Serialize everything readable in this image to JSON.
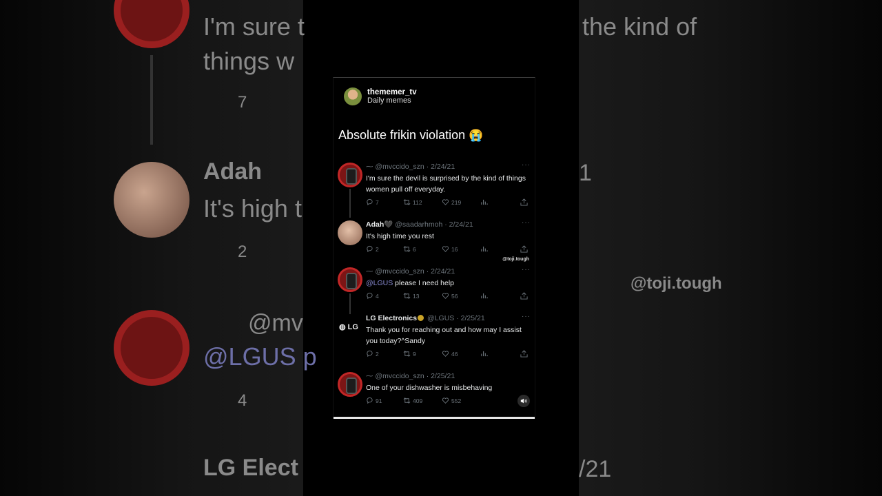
{
  "post": {
    "username": "thememer_tv",
    "subtitle": "Daily memes",
    "caption": "Absolute frikin violation",
    "caption_emoji": "😭",
    "watermark": "@toji.tough"
  },
  "tweets": [
    {
      "name": "",
      "handle": "@mvccido_szn",
      "date": "2/24/21",
      "text": "I'm sure the devil is surprised by the kind of things women pull off everyday.",
      "replies": "7",
      "retweets": "112",
      "likes": "219"
    },
    {
      "name": "Adah",
      "handle": "@saadarhmoh",
      "date": "2/24/21",
      "text": "It's high time you rest",
      "replies": "2",
      "retweets": "6",
      "likes": "16"
    },
    {
      "name": "",
      "handle": "@mvccido_szn",
      "date": "2/24/21",
      "mention": "@LGUS",
      "text": " please I need help",
      "replies": "4",
      "retweets": "13",
      "likes": "56"
    },
    {
      "name": "LG Electronics",
      "handle": "@LGUS",
      "date": "2/25/21",
      "text": "Thank you for reaching out and how may I assist you today?^Sandy",
      "replies": "2",
      "retweets": "9",
      "likes": "46"
    },
    {
      "name": "",
      "handle": "@mvccido_szn",
      "date": "2/25/21",
      "text": "One of your dishwasher is misbehaving",
      "replies": "91",
      "retweets": "409",
      "likes": "552"
    }
  ],
  "lg_logo_text": "LG",
  "backdrop": {
    "line1": "I'm sure t",
    "line1b": "the kind of",
    "line2": "things w",
    "name_adah": "Adah",
    "adah_text": "It's high t",
    "mention": "@LGUS p",
    "handle_frag": "@mv",
    "lg_name": "LG Elect",
    "watermark": "@toji.tough",
    "count7": "7",
    "count2": "2",
    "count4": "4",
    "date_frag1": "1",
    "date_frag2": "/21"
  },
  "icons": [
    "reply-icon",
    "retweet-icon",
    "like-icon",
    "views-icon",
    "share-icon",
    "verified-badge-icon",
    "volume-icon"
  ]
}
